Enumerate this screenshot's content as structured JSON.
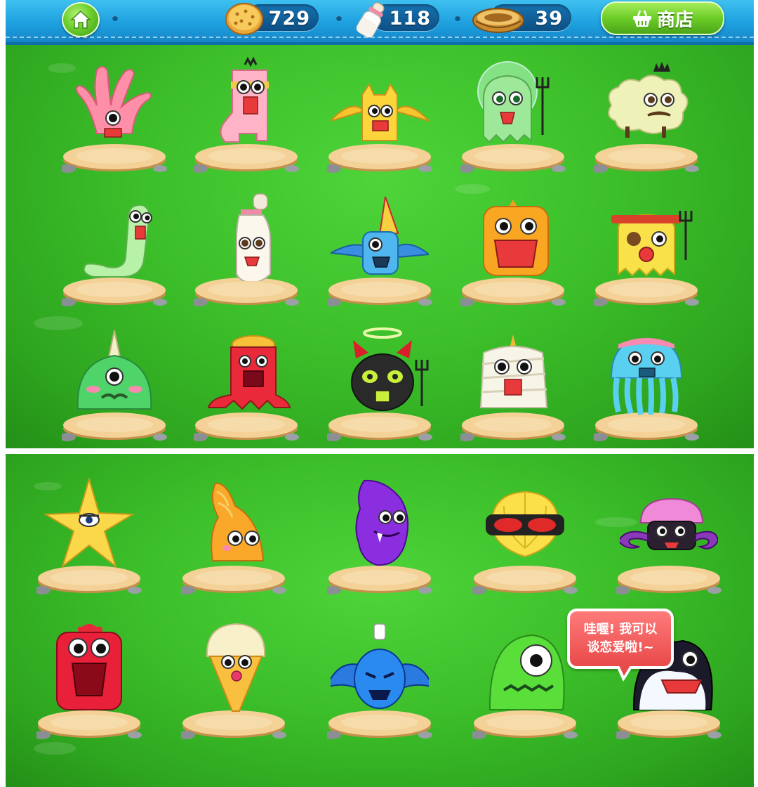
{
  "header": {
    "cookies": "729",
    "milk": "118",
    "rings": "39",
    "shop_label": "商店"
  },
  "icons": {
    "home": "home-icon",
    "cookie": "cookie-icon",
    "milk": "milk-bottle-icon",
    "ring": "ring-nest-icon",
    "shop": "basket-icon"
  },
  "speech_bubble": "哇喔! 我可以\n谈恋爱啦!~",
  "colors": {
    "sky_blue": "#1ea1df",
    "grass_green": "#3cbf2a",
    "shop_green": "#6ccd27",
    "bubble_red": "#e94a4a"
  }
}
